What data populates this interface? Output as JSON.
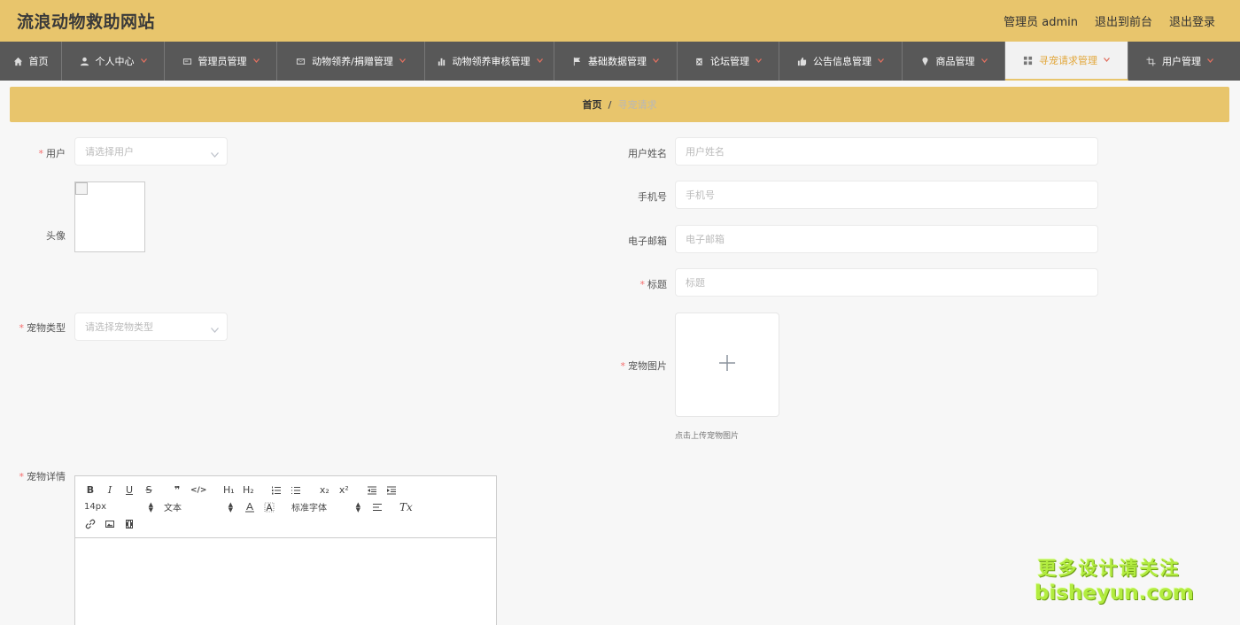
{
  "header": {
    "title": "流浪动物救助网站",
    "user_label": "管理员 admin",
    "back_label": "退出到前台",
    "logout_label": "退出登录"
  },
  "nav": [
    {
      "label": "首页",
      "icon": "home-icon"
    },
    {
      "label": "个人中心",
      "icon": "user-icon"
    },
    {
      "label": "管理员管理",
      "icon": "card-icon"
    },
    {
      "label": "动物领养/捐赠管理",
      "icon": "mail-icon"
    },
    {
      "label": "动物领养审核管理",
      "icon": "bar-chart-icon"
    },
    {
      "label": "基础数据管理",
      "icon": "flag-icon"
    },
    {
      "label": "论坛管理",
      "icon": "clipboard-icon"
    },
    {
      "label": "公告信息管理",
      "icon": "thumb-icon"
    },
    {
      "label": "商品管理",
      "icon": "pin-icon"
    },
    {
      "label": "寻宠请求管理",
      "icon": "grid-icon"
    },
    {
      "label": "用户管理",
      "icon": "crop-icon"
    }
  ],
  "breadcrumb": {
    "home": "首页",
    "separator": "/",
    "current": "寻宠请求"
  },
  "form": {
    "user_label": "用户",
    "user_placeholder": "请选择用户",
    "avatar_label": "头像",
    "pet_type_label": "宠物类型",
    "pet_type_placeholder": "请选择宠物类型",
    "detail_label": "宠物详情",
    "name_label": "用户姓名",
    "name_placeholder": "用户姓名",
    "phone_label": "手机号",
    "phone_placeholder": "手机号",
    "email_label": "电子邮箱",
    "email_placeholder": "电子邮箱",
    "title_label": "标题",
    "title_placeholder": "标题",
    "image_label": "宠物图片",
    "image_tip": "点击上传宠物图片",
    "required_mark": "*"
  },
  "editor": {
    "bold": "B",
    "italic": "I",
    "underline": "U",
    "strike": "S",
    "quote": "❞",
    "code": "</>",
    "h1": "H₁",
    "h2": "H₂",
    "sub": "x₂",
    "sup": "x²",
    "size": "14px",
    "header": "文本",
    "font": "标准字体",
    "clean": "Tx"
  },
  "watermark": {
    "line1": "更多设计请关注",
    "line2": "bisheyun.com"
  },
  "colors": {
    "header": "#e8c56c",
    "nav": "#585858",
    "active": "#e2a73a",
    "required": "#f56c6c"
  }
}
